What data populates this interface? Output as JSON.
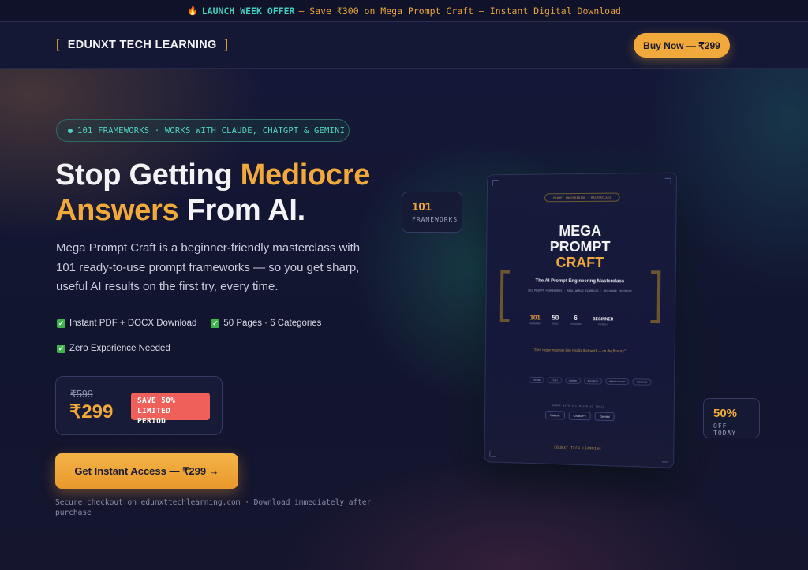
{
  "announcement": {
    "icon": "fire-icon",
    "highlight": "LAUNCH WEEK OFFER",
    "text": "— Save ₹300 on Mega Prompt Craft — Instant Digital Download"
  },
  "nav": {
    "bracket_left": "[",
    "brand": "EDUNXT TECH LEARNING",
    "bracket_right": "]",
    "buy_label": "Buy Now — ₹299"
  },
  "hero": {
    "badge": "101 FRAMEWORKS · WORKS WITH CLAUDE, CHATGPT & GEMINI",
    "headline_part1": "Stop Getting ",
    "headline_accent1": "Mediocre",
    "headline_accent2": "Answers",
    "headline_part2": " From AI.",
    "description": "Mega Prompt Craft is a beginner-friendly masterclass with 101 ready-to-use prompt frameworks — so you get sharp, useful AI results on the first try, every time.",
    "features": [
      "Instant PDF + DOCX Download",
      "50 Pages · 6 Categories",
      "Zero Experience Needed"
    ],
    "check_icon": "✓",
    "price": {
      "old": "₹599",
      "new": "₹299",
      "save_line1": "SAVE 50%",
      "save_line2": "LIMITED PERIOD"
    },
    "cta_label": "Get Instant Access — ₹299 →",
    "secure_note": "Secure checkout on edunxttechlearning.com · Download immediately after purchase"
  },
  "stats": [
    {
      "value": "101",
      "label": "FRAMEWORKS"
    },
    {
      "value": "50%",
      "label": "OFF TODAY"
    }
  ],
  "book": {
    "pill": "PROMPT ENGINEERING · MASTERCLASS",
    "title_line1": "MEGA",
    "title_line2": "PROMPT",
    "title_line3": "CRAFT",
    "subtitle": "The AI Prompt Engineering Masterclass",
    "subline": "101 PROMPT FRAMEWORKS · REAL-WORLD EXAMPLES · BEGINNER FRIENDLY",
    "stats": [
      {
        "n": "101",
        "l": "FRAMEWORKS"
      },
      {
        "n": "50",
        "l": "PAGES"
      },
      {
        "n": "6",
        "l": "CATEGORIES"
      },
      {
        "n": "BEGINNER",
        "l": "FRIENDLY"
      }
    ],
    "quote": "\"Turn vague requests into results that work — on the first try\"",
    "tags": [
      "CODING",
      "STUDY",
      "CAREER",
      "BUSINESS",
      "PRODUCTIVITY",
      "CREATIVE"
    ],
    "works_with": "WORKS WITH ALL MAJOR AI TOOLS",
    "chips": [
      "Claude",
      "ChatGPT",
      "Gemini"
    ],
    "footer": "EDUNXT TECH LEARNING"
  }
}
